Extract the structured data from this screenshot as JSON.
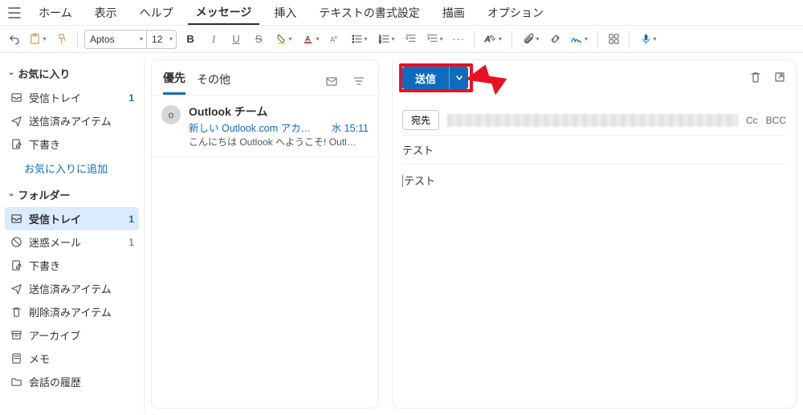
{
  "menus": {
    "home": "ホーム",
    "view": "表示",
    "help": "ヘルプ",
    "message": "メッセージ",
    "insert": "挿入",
    "textformat": "テキストの書式設定",
    "draw": "描画",
    "options": "オプション"
  },
  "ribbon": {
    "font_name": "Aptos",
    "font_size": "12"
  },
  "sidebar": {
    "favorites_label": "お気に入り",
    "fav_inbox": "受信トレイ",
    "fav_inbox_count": "1",
    "fav_sent": "送信済みアイテム",
    "fav_drafts": "下書き",
    "fav_add": "お気に入りに追加",
    "folders_label": "フォルダー",
    "inbox": "受信トレイ",
    "inbox_count": "1",
    "junk": "迷惑メール",
    "junk_count": "1",
    "drafts": "下書き",
    "sent": "送信済みアイテム",
    "deleted": "削除済みアイテム",
    "archive": "アーカイブ",
    "notes": "メモ",
    "history": "会話の履歴"
  },
  "tabs": {
    "focused": "優先",
    "other": "その他"
  },
  "msg": {
    "sender": "Outlook チーム",
    "subject": "新しい Outlook.com アカ…",
    "time": "水 15:11",
    "preview": "こんにちは Outlook へようこそ! Outl…",
    "avatar": "o"
  },
  "compose": {
    "send": "送信",
    "to_label": "宛先",
    "cc": "Cc",
    "bcc": "BCC",
    "subject": "テスト",
    "body": "テスト"
  }
}
